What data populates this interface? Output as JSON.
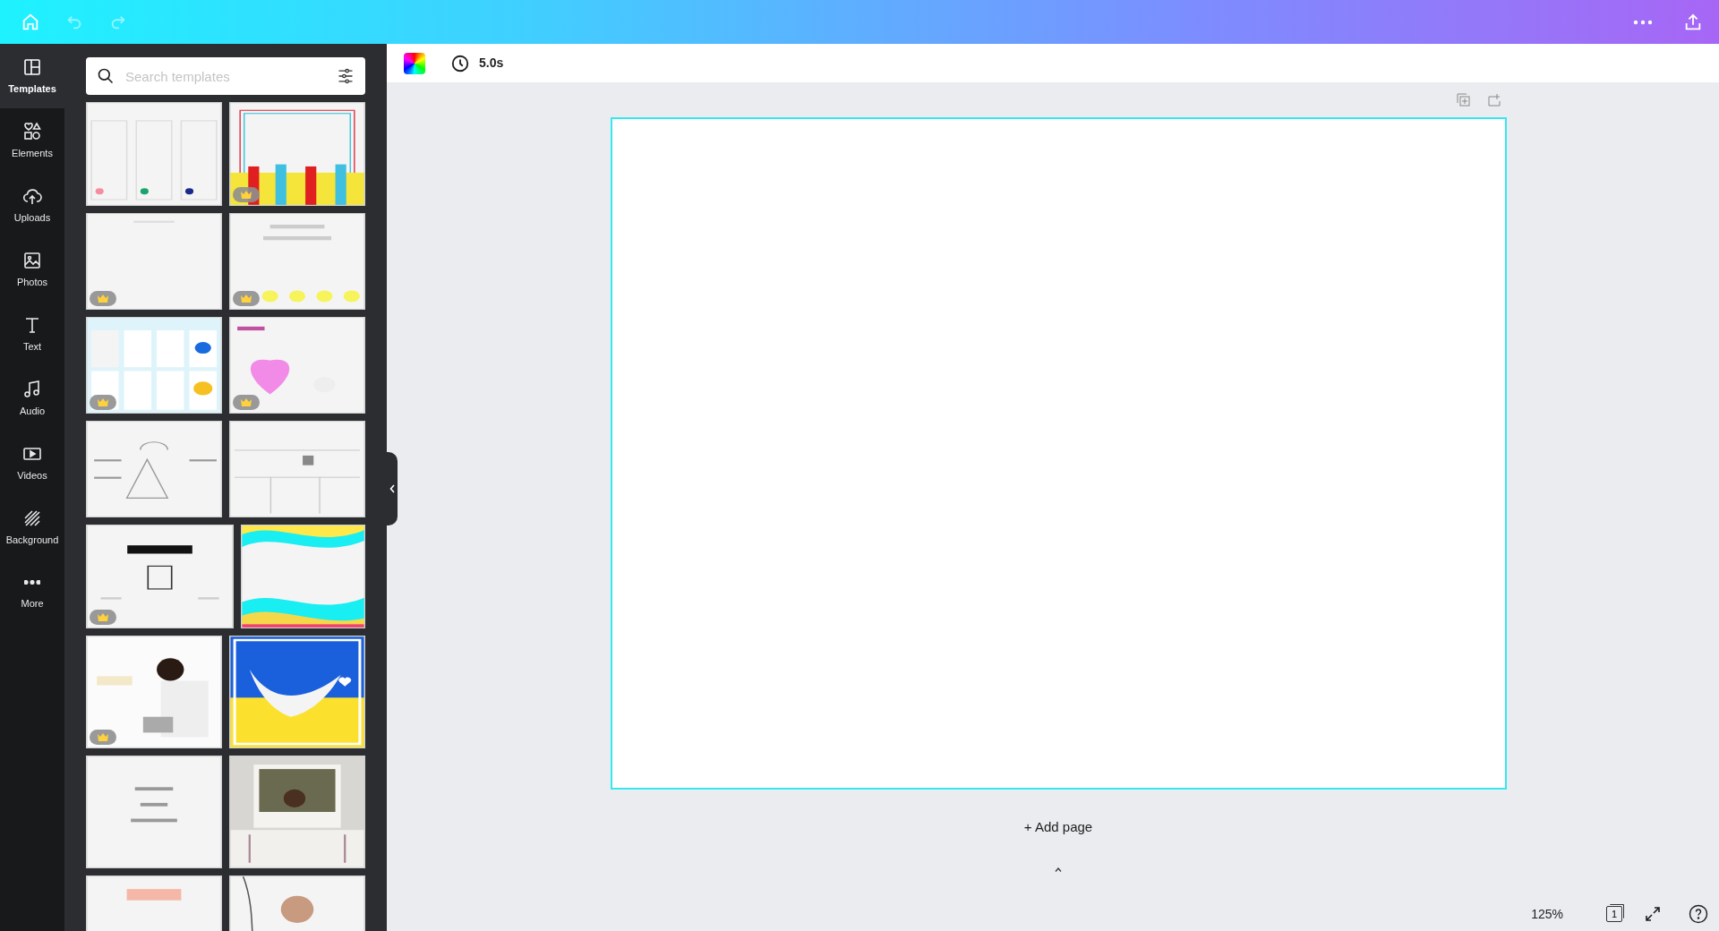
{
  "sidebar": {
    "items": [
      {
        "label": "Templates",
        "selected": true
      },
      {
        "label": "Elements",
        "selected": false
      },
      {
        "label": "Uploads",
        "selected": false
      },
      {
        "label": "Photos",
        "selected": false
      },
      {
        "label": "Text",
        "selected": false
      },
      {
        "label": "Audio",
        "selected": false
      },
      {
        "label": "Videos",
        "selected": false
      },
      {
        "label": "Background",
        "selected": false
      },
      {
        "label": "More",
        "selected": false
      }
    ]
  },
  "search": {
    "placeholder": "Search templates"
  },
  "templates": [
    [
      {
        "kind": "picture",
        "premium": false
      },
      {
        "kind": "picture",
        "premium": true
      }
    ],
    [
      {
        "kind": "picture",
        "premium": true
      },
      {
        "kind": "picture",
        "premium": true
      }
    ],
    [
      {
        "kind": "picture",
        "premium": true
      },
      {
        "kind": "picture",
        "premium": true
      }
    ],
    [
      {
        "kind": "picture",
        "premium": false
      },
      {
        "kind": "picture",
        "premium": false
      }
    ],
    [
      {
        "kind": "picture",
        "premium": true
      },
      {
        "kind": "picture",
        "premium": false
      }
    ],
    [
      {
        "kind": "picture",
        "premium": true
      },
      {
        "kind": "picture",
        "premium": false
      }
    ],
    [
      {
        "kind": "picture",
        "premium": false
      },
      {
        "kind": "picture",
        "premium": false
      }
    ],
    [
      {
        "kind": "picture",
        "premium": false
      },
      {
        "kind": "picture",
        "premium": false
      }
    ]
  ],
  "toolbar": {
    "duration": "5.0s"
  },
  "canvas": {
    "add_page": "+ Add page"
  },
  "footer": {
    "zoom": "125%",
    "page_count": "1"
  }
}
